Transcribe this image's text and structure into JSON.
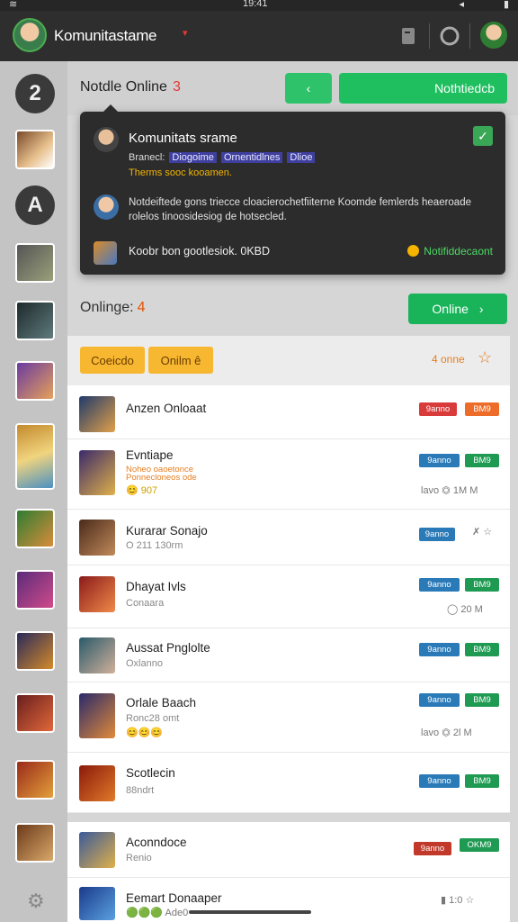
{
  "status_bar": {
    "time": "19:41",
    "wifi_icon": "wifi-icon",
    "signal": "◂",
    "battery_icon": "battery-icon"
  },
  "header": {
    "title": "Komunitastame",
    "caret": "▾",
    "icons": [
      "document-icon",
      "record-icon"
    ]
  },
  "rail": {
    "badge_number": "2",
    "letter": "A",
    "settings_icon": "gear-icon"
  },
  "notice": {
    "title": "Notdle Online",
    "count": "3",
    "back_label": "‹",
    "notif_label": "Nothtiedcb"
  },
  "popup": {
    "title": "Komunitats srame",
    "tag_prefix": "Branecl:",
    "tags": [
      "Diogoime",
      "Ornentidlnes",
      "Dlioe"
    ],
    "orange_line": "Therms sooc kooamen.",
    "message": "Notdeiftede gons triecce cloacierochetfiiterne Koomde femlerds heaeroade rolelos tinoosidesiog de hotsecled.",
    "footer": "Koobr bon gootlesiok. 0KBD",
    "status": "Notifiddecaont"
  },
  "online": {
    "title": "Onlinge:",
    "count": "4",
    "button": "Online",
    "arrow": "›"
  },
  "filters": {
    "chips": [
      "Coeicdo",
      "Onilm ê"
    ],
    "count_text": "4 onne",
    "star_icon": "star-icon"
  },
  "games": [
    {
      "name": "Anzen Onloaat",
      "sub": "",
      "badges": [
        {
          "text": "9anno",
          "color": "red"
        },
        {
          "text": "BM9",
          "color": "orange"
        }
      ],
      "meta": ""
    },
    {
      "name": "Evntiape",
      "sub": "Noheo oaoetonce",
      "sub2": "Ponnecloneos ode",
      "emo": "😊 907",
      "badges": [
        {
          "text": "9anno",
          "color": "blue"
        },
        {
          "text": "BM9",
          "color": "green"
        }
      ],
      "meta": "lavo  ⏣  1M  M"
    },
    {
      "name": "Kurarar Sonajo",
      "sub": "O 211 130rm",
      "badges": [
        {
          "text": "9anno",
          "color": "blue"
        }
      ],
      "meta": "✗ ☆"
    },
    {
      "name": "Dhayat Ivls",
      "sub": "Conaara",
      "badges": [
        {
          "text": "9anno",
          "color": "blue"
        },
        {
          "text": "BM9",
          "color": "green"
        }
      ],
      "meta": "◯   20  M"
    },
    {
      "name": "Aussat Pnglolte",
      "sub": "Oxlanno",
      "badges": [
        {
          "text": "9anno",
          "color": "blue"
        },
        {
          "text": "BM9",
          "color": "green"
        }
      ],
      "meta": ""
    },
    {
      "name": "Orlale Baach",
      "sub": "Ronc28 omt",
      "emo": "😊😊😊",
      "badges": [
        {
          "text": "9anno",
          "color": "blue"
        },
        {
          "text": "BM9",
          "color": "green"
        }
      ],
      "meta": "lavo  ⏣  2l  M"
    },
    {
      "name": "Scotlecin",
      "sub": "88ndrt",
      "badges": [
        {
          "text": "9anno",
          "color": "blue"
        },
        {
          "text": "BM9",
          "color": "green"
        }
      ],
      "meta": ""
    },
    {
      "name": "Aconndoce",
      "sub": "Renio",
      "badges": [
        {
          "text": "9anno",
          "color": "dkred"
        },
        {
          "text": "OKM9",
          "color": "green"
        }
      ],
      "meta": ""
    },
    {
      "name": "Eemart Donaaper",
      "sub": "",
      "emo": "🟢🟢🟢 Ade0",
      "badges": [],
      "meta": "▮ 1:0  ☆"
    }
  ],
  "colors": {
    "accent_green": "#1fbf5f",
    "popup_bg": "#2c2c2c",
    "chip_yellow": "#f7b731",
    "badge_blue": "#2a7ab8",
    "badge_green": "#1f9a52",
    "badge_red": "#d93a3a"
  }
}
